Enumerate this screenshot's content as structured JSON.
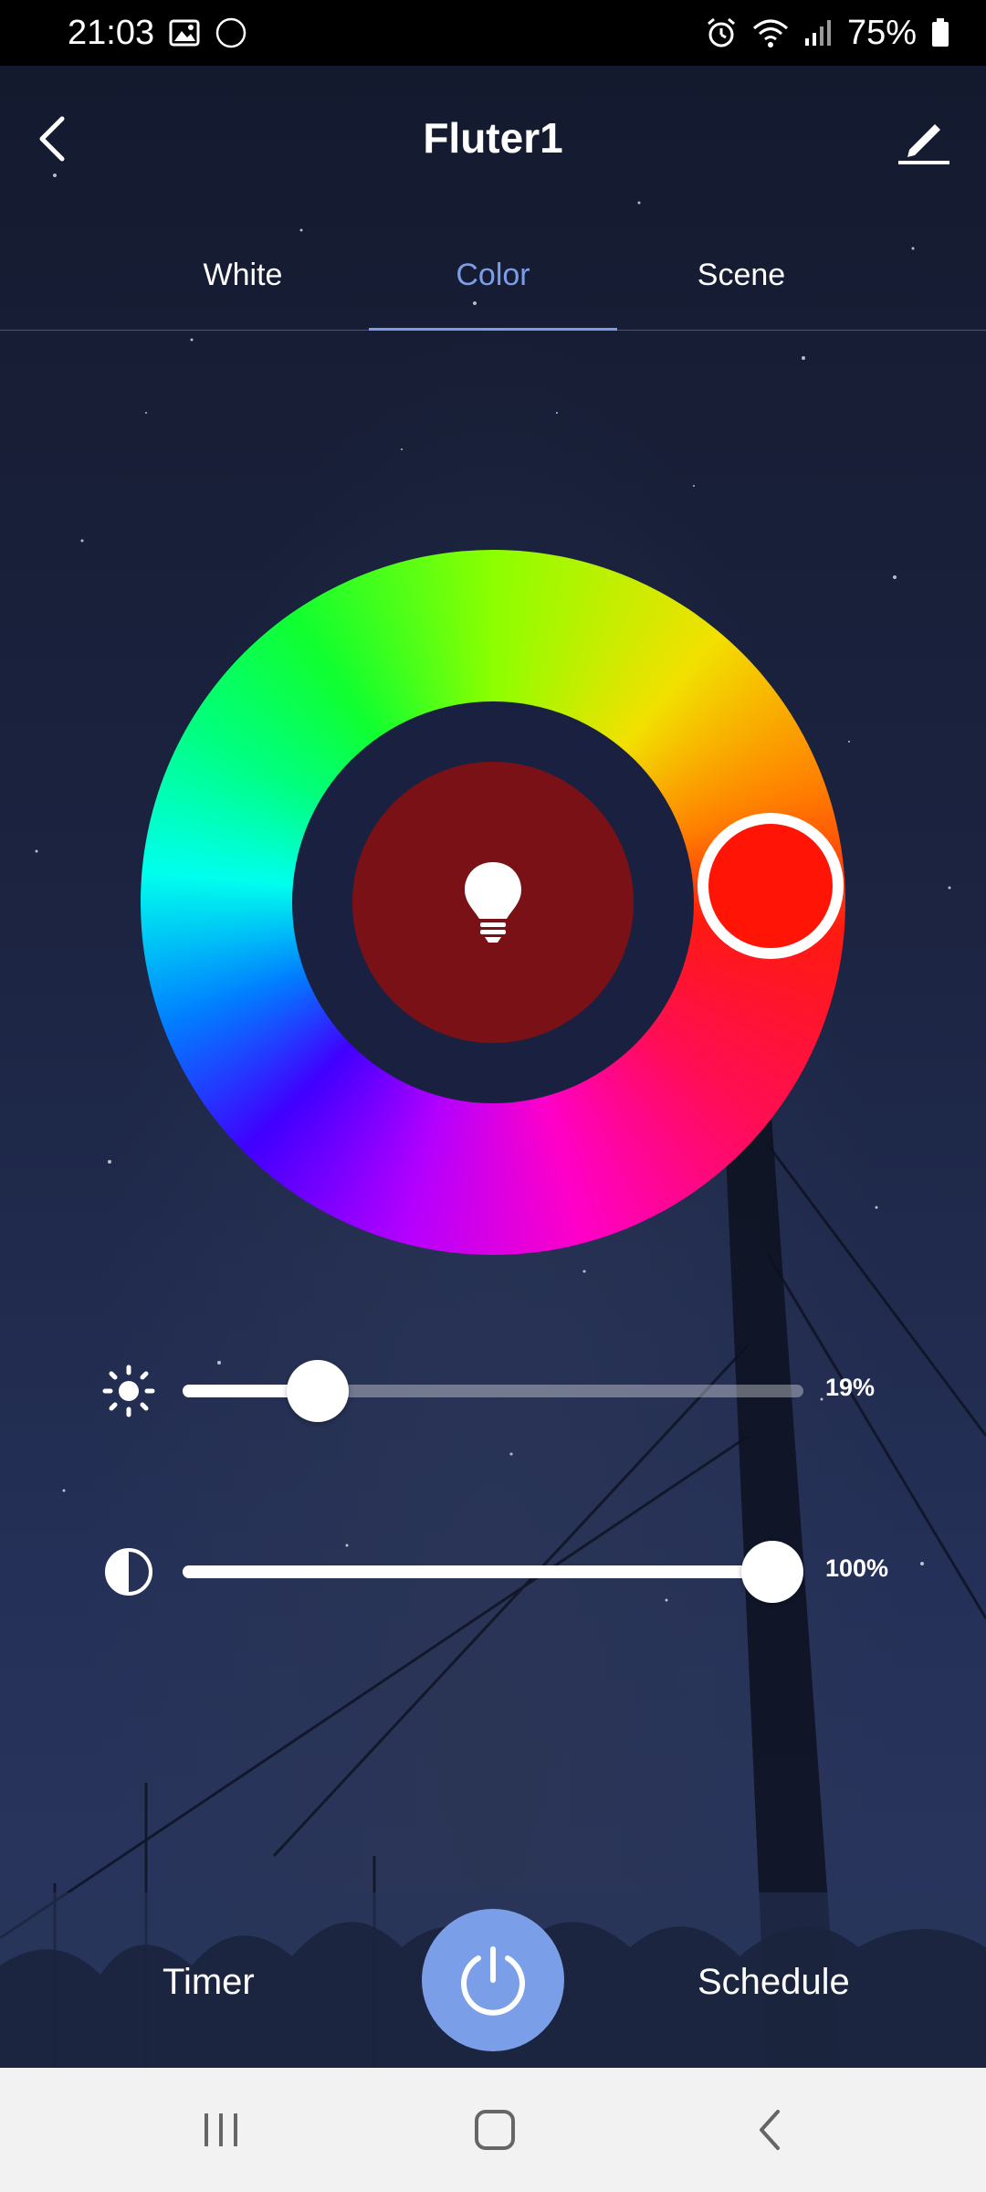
{
  "status_bar": {
    "time": "21:03",
    "notification_badge": "75",
    "battery": "75%",
    "icons": [
      "image-icon",
      "badge-icon",
      "alarm-icon",
      "wifi-icon",
      "signal-icon",
      "battery-icon"
    ]
  },
  "header": {
    "title": "Fluter1",
    "back_icon": "chevron-left-icon",
    "edit_icon": "pencil-icon"
  },
  "tabs": [
    {
      "label": "White",
      "active": false
    },
    {
      "label": "Color",
      "active": true
    },
    {
      "label": "Scene",
      "active": false
    }
  ],
  "color_picker": {
    "selected_color": "#ff1406",
    "preview_color": "#7a1116",
    "center_icon": "bulb-icon"
  },
  "sliders": {
    "brightness": {
      "icon": "sun-icon",
      "value": 19,
      "label": "19%"
    },
    "saturation": {
      "icon": "contrast-icon",
      "value": 100,
      "label": "100%"
    }
  },
  "bottom_bar": {
    "timer_label": "Timer",
    "schedule_label": "Schedule",
    "power_icon": "power-icon",
    "power_color": "#7a9fe8"
  },
  "nav_bar": {
    "icons": [
      "recents-icon",
      "home-icon",
      "back-icon"
    ]
  },
  "colors": {
    "accent": "#7d9ee6",
    "background": "#1b2340"
  }
}
